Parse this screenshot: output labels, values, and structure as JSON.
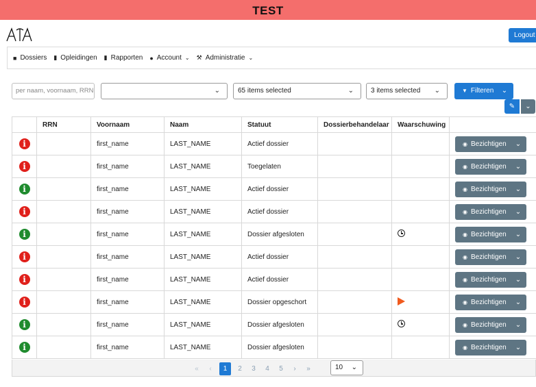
{
  "banner": {
    "env": "TEST"
  },
  "header": {
    "logout_label": "Logout",
    "logo_icon": "apa-logo-icon"
  },
  "nav": {
    "items": [
      {
        "label": "Dossiers",
        "icon": "folder-icon"
      },
      {
        "label": "Opleidingen",
        "icon": "book-icon"
      },
      {
        "label": "Rapporten",
        "icon": "document-icon"
      },
      {
        "label": "Account",
        "icon": "user-icon",
        "dropdown": true
      },
      {
        "label": "Administratie",
        "icon": "wrench-icon",
        "dropdown": true
      }
    ]
  },
  "filters": {
    "search_placeholder": "per naam, voornaam, RRN",
    "select1_value": "",
    "select2_value": "65 items selected",
    "select3_value": "3 items selected",
    "filter_label": "Filteren"
  },
  "table": {
    "columns": [
      "",
      "RRN",
      "Voornaam",
      "Naam",
      "Statuut",
      "Dossierbehandelaar",
      "Waarschuwing",
      ""
    ],
    "action_label": "Bezichtigen",
    "rows": [
      {
        "status": "red",
        "rrn": "",
        "voornaam": "first_name",
        "naam": "LAST_NAME",
        "statuut": "Actief dossier",
        "behandelaar": "",
        "warning": ""
      },
      {
        "status": "red",
        "rrn": "",
        "voornaam": "first_name",
        "naam": "LAST_NAME",
        "statuut": "Toegelaten",
        "behandelaar": "",
        "warning": ""
      },
      {
        "status": "green",
        "rrn": "",
        "voornaam": "first_name",
        "naam": "LAST_NAME",
        "statuut": "Actief dossier",
        "behandelaar": "",
        "warning": ""
      },
      {
        "status": "red",
        "rrn": "",
        "voornaam": "first_name",
        "naam": "LAST_NAME",
        "statuut": "Actief dossier",
        "behandelaar": "",
        "warning": ""
      },
      {
        "status": "green",
        "rrn": "",
        "voornaam": "first_name",
        "naam": "LAST_NAME",
        "statuut": "Dossier afgesloten",
        "behandelaar": "",
        "warning": "clock"
      },
      {
        "status": "red",
        "rrn": "",
        "voornaam": "first_name",
        "naam": "LAST_NAME",
        "statuut": "Actief dossier",
        "behandelaar": "",
        "warning": ""
      },
      {
        "status": "red",
        "rrn": "",
        "voornaam": "first_name",
        "naam": "LAST_NAME",
        "statuut": "Actief dossier",
        "behandelaar": "",
        "warning": ""
      },
      {
        "status": "red",
        "rrn": "",
        "voornaam": "first_name",
        "naam": "LAST_NAME",
        "statuut": "Dossier opgeschort",
        "behandelaar": "",
        "warning": "flag"
      },
      {
        "status": "green",
        "rrn": "",
        "voornaam": "first_name",
        "naam": "LAST_NAME",
        "statuut": "Dossier afgesloten",
        "behandelaar": "",
        "warning": "clock"
      },
      {
        "status": "green",
        "rrn": "",
        "voornaam": "first_name",
        "naam": "LAST_NAME",
        "statuut": "Dossier afgesloten",
        "behandelaar": "",
        "warning": ""
      }
    ]
  },
  "pagination": {
    "first": "«",
    "prev": "‹",
    "pages": [
      "1",
      "2",
      "3",
      "4",
      "5"
    ],
    "current": "1",
    "next": "›",
    "last": "»",
    "page_size": "10"
  },
  "colors": {
    "banner": "#f46e6c",
    "primary": "#1f7ad4",
    "secondary": "#5e7583",
    "status_red": "#e0201b",
    "status_green": "#1f8b2e",
    "warning_flag": "#f05a1e"
  }
}
